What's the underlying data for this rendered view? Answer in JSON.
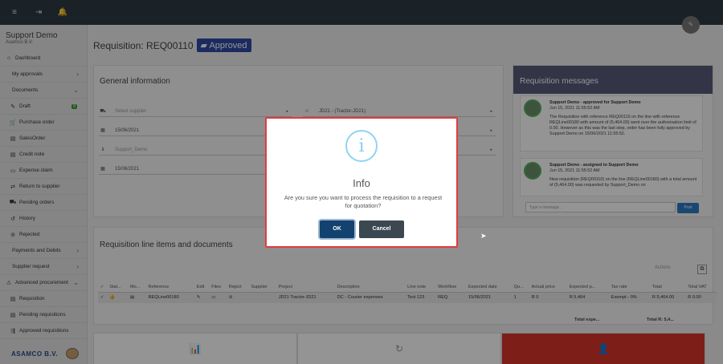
{
  "topbar": {
    "menu_icon": "≡",
    "logout_icon": "⇥",
    "bell_icon": "🔔"
  },
  "sidebar": {
    "company": "Support Demo",
    "company_sub": "Asamco B.V.",
    "items": [
      {
        "label": "Dashboard",
        "icon": "⌂"
      },
      {
        "label": "My approvals",
        "icon": ""
      },
      {
        "label": "Documents",
        "icon": ""
      },
      {
        "label": "Draft",
        "icon": "✎",
        "badge": "8"
      },
      {
        "label": "Purchase order",
        "icon": "🛒"
      },
      {
        "label": "SalesOrder",
        "icon": "▤"
      },
      {
        "label": "Credit note",
        "icon": "▤"
      },
      {
        "label": "Expense claim",
        "icon": "▭"
      },
      {
        "label": "Return to supplier",
        "icon": "⇄"
      },
      {
        "label": "Pending orders",
        "icon": "⛟"
      },
      {
        "label": "History",
        "icon": "↺"
      },
      {
        "label": "Rejected",
        "icon": "⊘"
      },
      {
        "label": "Payments and Debits",
        "icon": ""
      },
      {
        "label": "Supplier request",
        "icon": ""
      },
      {
        "label": "Advanced procurement",
        "icon": "⚠"
      },
      {
        "label": "Requisition",
        "icon": "▤"
      },
      {
        "label": "Pending requisitions",
        "icon": "▤"
      },
      {
        "label": "Approved requisitions",
        "icon": "⇶"
      }
    ],
    "logo": "ASAMCO B.V."
  },
  "page": {
    "title": "Requisition: REQ00110",
    "status": "Approved",
    "status_icon": "▰"
  },
  "general": {
    "title": "General information",
    "fields": {
      "supplier": "Select supplier",
      "project": "JD21 - (Tractor-JD21)",
      "date1": "15/06/2021",
      "requester": "Support_Demo",
      "date2": "15/06/2021"
    }
  },
  "messages": {
    "title": "Requisition messages",
    "items": [
      {
        "title": "Support Demo - approved for Support Demo",
        "time": "Jun 15, 2021 11:55:52 AM",
        "body": "The Requisition with reference REQ00110 on the line with reference REQLine00180 with amount of (5,464.00) went over the authorisation limit of 0.00. However as this was the last step, order has been fully approved by Support Demo on 15/06/2021 11:55:52."
      },
      {
        "title": "Support Demo - assigned to Support Demo",
        "time": "Jun 15, 2021 11:55:52 AM",
        "body": "New requisition (REQ00110) on the line (REQLine00180) with a total amount of (5,464.00) was requested by Support_Demo on"
      }
    ],
    "input_placeholder": "Type a message...",
    "post_label": "Post"
  },
  "lines": {
    "title": "Requisition line items and documents",
    "action_label": "Actions",
    "headers": [
      "✓",
      "Stat...",
      "Mo...",
      "Reference",
      "Edit",
      "Files",
      "Reject",
      "Supplier",
      "Project",
      "Description",
      "Line note",
      "Workflow",
      "Expected date",
      "Qu...",
      "Actual price",
      "Expected p...",
      "Tax rate",
      "Total",
      "Total VAT"
    ],
    "rows": [
      [
        "✓",
        "👍",
        "▤",
        "REQLine00180",
        "✎",
        "▭",
        "⊘",
        "",
        "JD21 Tractor-JD21",
        "DC - Courier expenses",
        "Test 123",
        "REQ",
        "15/06/2021",
        "1",
        "R 0",
        "R 5,464",
        "Exempt - 0%",
        "R 5,464.00",
        "R 0.00"
      ]
    ],
    "total_expected": "Total expe...",
    "total_r": "Total R: 5,4..."
  },
  "dialog": {
    "icon": "i",
    "title": "Info",
    "text": "Are you sure you want to process the requisition to a request for quotation?",
    "ok": "OK",
    "cancel": "Cancel"
  }
}
